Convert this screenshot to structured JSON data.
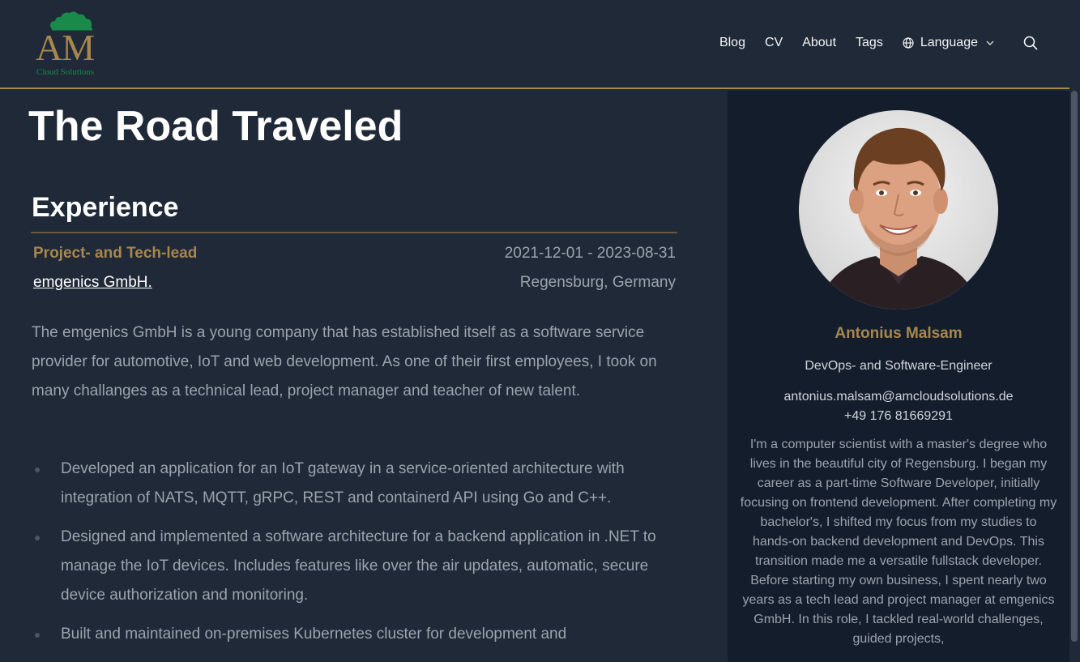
{
  "header": {
    "logo": {
      "text": "AM",
      "subtitle": "Cloud Solutions"
    },
    "nav": [
      {
        "label": "Blog"
      },
      {
        "label": "CV"
      },
      {
        "label": "About"
      },
      {
        "label": "Tags"
      }
    ],
    "language": {
      "label": "Language",
      "icon": "globe-icon"
    },
    "search": {
      "icon": "search-icon"
    }
  },
  "main": {
    "title": "The Road Traveled",
    "section_title": "Experience",
    "entry": {
      "role": "Project- and Tech-lead",
      "dates": "2021-12-01 - 2023-08-31",
      "company": "emgenics GmbH.",
      "location": "Regensburg, Germany",
      "description": "The emgenics GmbH is a young company that has established itself as a software service provider for automotive, IoT and web development. As one of their first employees, I took on many challanges as a technical lead, project manager and teacher of new talent.",
      "bullets": [
        "Developed an application for an IoT gateway in a service-oriented architecture with integration of NATS, MQTT, gRPC, REST and containerd API using Go and C++.",
        "Designed and implemented a software architecture for a backend application in .NET to manage the IoT devices. Includes features like over the air updates, automatic, secure device authorization and monitoring.",
        "Built and maintained on-premises Kubernetes cluster for development and"
      ]
    }
  },
  "sidebar": {
    "name": "Antonius Malsam",
    "job": "DevOps- and Software-Engineer",
    "email": "antonius.malsam@amcloudsolutions.de",
    "phone": "+49 176 81669291",
    "bio": "I'm a computer scientist with a master's degree who lives in the beautiful city of Regensburg. I began my career as a part-time Software Developer, initially focusing on frontend development. After completing my bachelor's, I shifted my focus from my studies to hands-on backend development and DevOps. This transition made me a versatile fullstack developer. Before starting my own business, I spent nearly two years as a tech lead and project manager at emgenics GmbH. In this role, I tackled real-world challenges, guided projects,"
  },
  "colors": {
    "background": "#1f2937",
    "sidebar": "#141d2c",
    "accent": "#a8874f",
    "logo_green": "#1a8a4a"
  }
}
